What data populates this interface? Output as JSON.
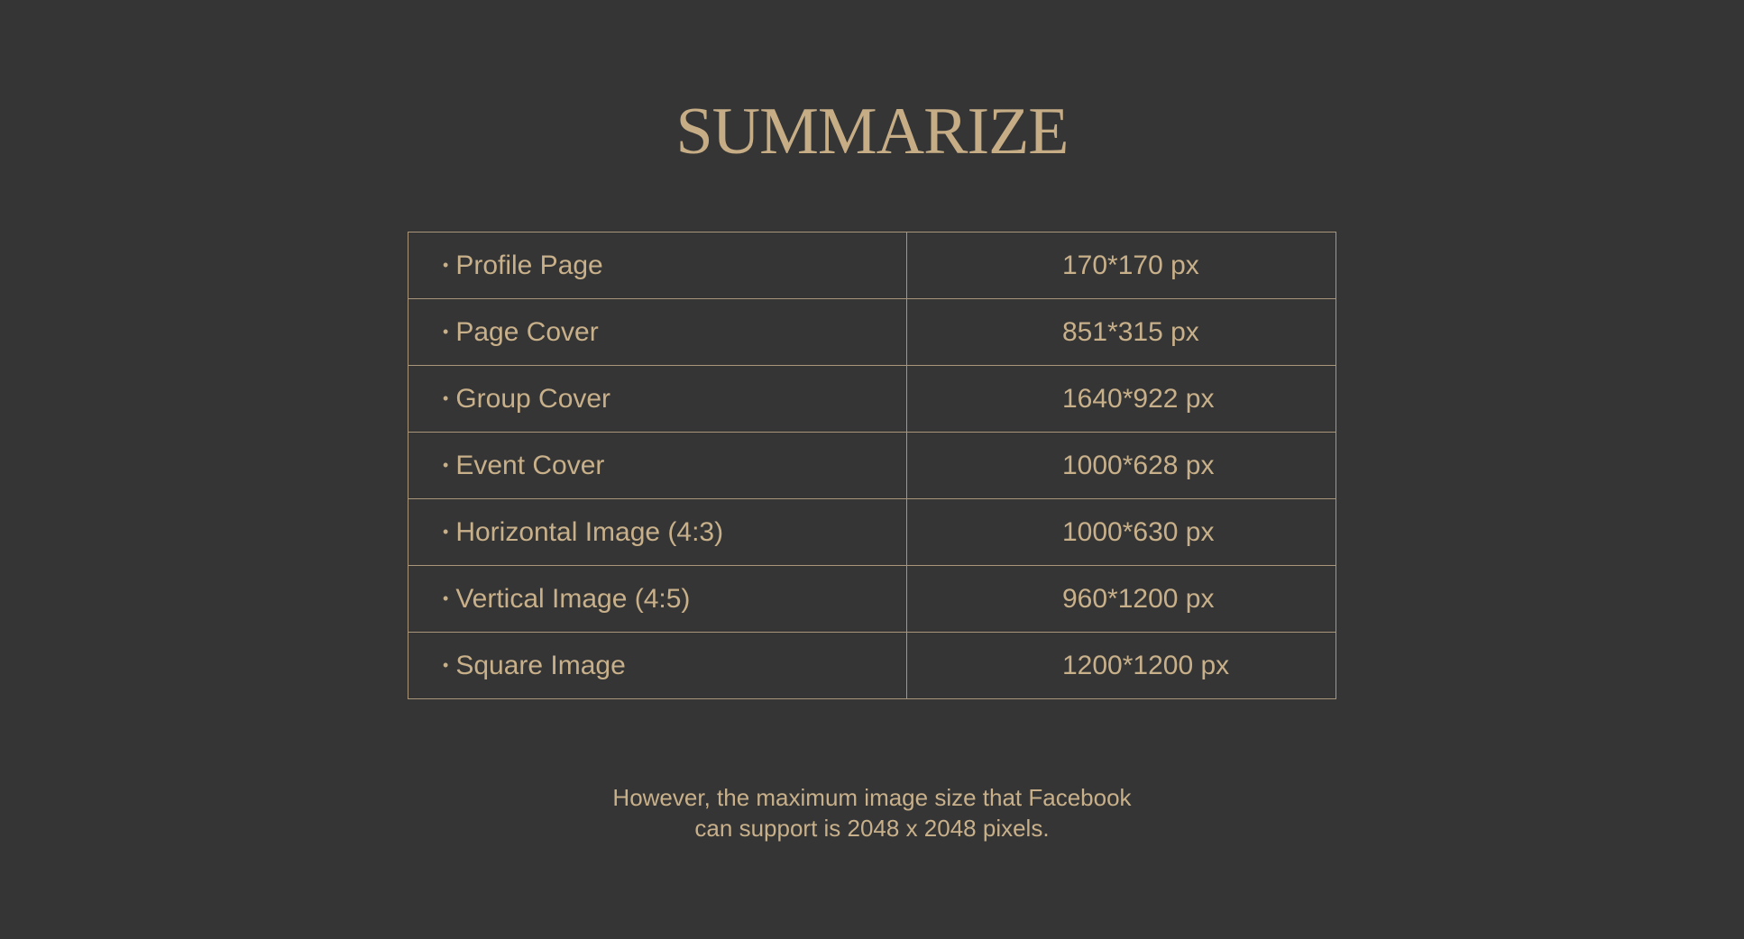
{
  "title": "SUMMARIZE",
  "bullet_glyph": "•",
  "table": {
    "rows": [
      {
        "label": "Profile Page",
        "value": "170*170 px"
      },
      {
        "label": "Page Cover",
        "value": "851*315 px"
      },
      {
        "label": "Group Cover",
        "value": "1640*922 px"
      },
      {
        "label": "Event Cover",
        "value": "1000*628 px"
      },
      {
        "label": "Horizontal Image (4:3)",
        "value": "1000*630 px"
      },
      {
        "label": "Vertical Image (4:5)",
        "value": "960*1200 px"
      },
      {
        "label": "Square Image",
        "value": "1200*1200 px"
      }
    ]
  },
  "footer": {
    "line1": "However, the maximum image size that Facebook",
    "line2": "can support is 2048 x 2048 pixels."
  },
  "colors": {
    "background": "#353535",
    "text": "#c8b08a",
    "border": "#a8957a"
  }
}
